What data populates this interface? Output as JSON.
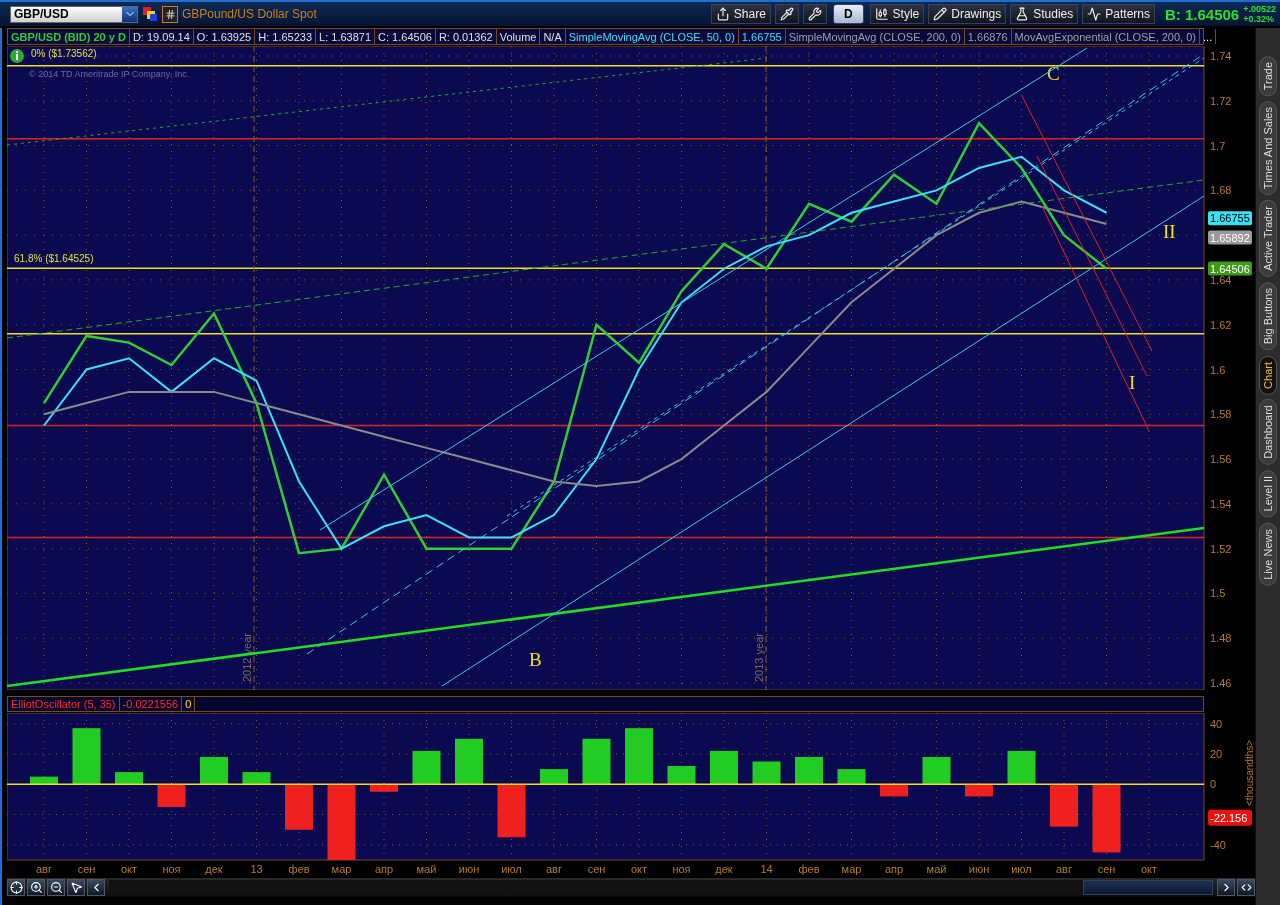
{
  "symbol": {
    "value": "GBP/USD",
    "description": "GBPound/US Dollar Spot"
  },
  "toolbar": [
    {
      "kind": "text",
      "label": "Share"
    },
    {
      "kind": "icon"
    },
    {
      "kind": "icon"
    },
    {
      "kind": "toggle",
      "label": "D"
    },
    {
      "kind": "text",
      "label": "Style"
    },
    {
      "kind": "text",
      "label": "Drawings"
    },
    {
      "kind": "text",
      "label": "Studies"
    },
    {
      "kind": "text",
      "label": "Patterns"
    }
  ],
  "quote": {
    "bid": "B: 1.64506",
    "change": "+.00522",
    "change_percent": "+0.32%"
  },
  "info_cells": [
    {
      "text": "GBP/USD (BID) 20 y D",
      "kind": "symbol"
    },
    {
      "text": "D: 19.09.14",
      "kind": "field"
    },
    {
      "text": "O: 1.63925",
      "kind": "field"
    },
    {
      "text": "H: 1.65233",
      "kind": "field"
    },
    {
      "text": "L: 1.63871",
      "kind": "field"
    },
    {
      "text": "C: 1.64506",
      "kind": "field"
    },
    {
      "text": "R: 0.01362",
      "kind": "field"
    },
    {
      "text": "Volume",
      "kind": "field"
    },
    {
      "text": "N/A",
      "kind": "field"
    },
    {
      "text": "SimpleMovingAvg (CLOSE, 50, 0)",
      "kind": "primary"
    },
    {
      "text": "1.66755",
      "kind": "primary"
    },
    {
      "text": "SimpleMovingAvg (CLOSE, 200, 0)",
      "kind": "secondary"
    },
    {
      "text": "1.66876",
      "kind": "secondary"
    },
    {
      "text": "MovAvgExponential (CLOSE, 200, 0)",
      "kind": "secondary"
    },
    {
      "text": "...",
      "kind": "more"
    }
  ],
  "copyright": "© 2014 TD Ameritrade IP Company, Inc.",
  "price_chart": {
    "chart_data": {
      "type": "line",
      "grid": true,
      "series": [
        {
          "color": "#33cc33",
          "values": [
            1.585,
            1.615,
            1.612,
            1.602,
            1.625,
            1.585,
            1.518,
            1.52,
            1.553,
            1.52,
            1.52,
            1.52,
            1.55,
            1.62,
            1.603,
            1.635,
            1.656,
            1.645,
            1.674,
            1.666,
            1.687,
            1.674,
            1.71,
            1.69,
            1.66,
            1.645,
            null
          ]
        },
        {
          "color": "#3ce0f5",
          "values": [
            1.575,
            1.6,
            1.605,
            1.59,
            1.605,
            1.595,
            1.55,
            1.52,
            1.53,
            1.535,
            1.525,
            1.525,
            1.535,
            1.56,
            1.6,
            1.63,
            1.645,
            1.655,
            1.66,
            1.67,
            1.675,
            1.68,
            1.69,
            1.695,
            1.68,
            1.67,
            null
          ]
        },
        {
          "color": "#8a8a8a",
          "values": [
            1.58,
            1.585,
            1.59,
            1.59,
            1.59,
            1.585,
            1.58,
            1.575,
            1.57,
            1.565,
            1.56,
            1.555,
            1.55,
            1.548,
            1.55,
            1.56,
            1.575,
            1.59,
            1.61,
            1.63,
            1.645,
            1.66,
            1.67,
            1.675,
            1.67,
            1.665,
            null
          ]
        }
      ],
      "ylim": [
        1.46,
        1.74
      ],
      "yticks": [
        1.46,
        1.48,
        1.5,
        1.52,
        1.54,
        1.56,
        1.58,
        1.6,
        1.62,
        1.64,
        1.68,
        1.7,
        1.72,
        1.74
      ],
      "ref_lines": [
        {
          "axis": "y",
          "value": 1.73562,
          "color": "#f0e020",
          "label": "0% ($1.73562)"
        },
        {
          "axis": "y",
          "value": 1.703,
          "color": "#e02020"
        },
        {
          "axis": "y",
          "value": 1.64525,
          "color": "#f0e020",
          "label": "61.8% ($1.64525)"
        },
        {
          "axis": "y",
          "value": 1.616,
          "color": "#f0e020"
        },
        {
          "axis": "y",
          "value": 1.575,
          "color": "#e02020"
        },
        {
          "axis": "y",
          "value": 1.525,
          "color": "#e02020"
        }
      ]
    },
    "wave_labels": [
      "C",
      "B",
      "I",
      "II"
    ],
    "year_labels": [
      "2012 year",
      "2013 year"
    ],
    "badges": [
      {
        "text": "1.66755",
        "kind": "primary"
      },
      {
        "text": "1.65892",
        "kind": "secondary"
      },
      {
        "text": "1.64506",
        "kind": "price"
      }
    ]
  },
  "oscillator": {
    "header": [
      {
        "text": "ElliotOscillator (5, 35)",
        "kind": "study"
      },
      {
        "text": "-0.0221556",
        "kind": "study"
      },
      {
        "text": "0",
        "kind": "zero"
      }
    ],
    "chart_data": {
      "type": "bar",
      "grid": true,
      "ylabel": "<thousandths>",
      "ylim": [
        -50,
        47
      ],
      "yticks": [
        40,
        20,
        0,
        -40
      ],
      "categories": [
        "авг",
        "сен",
        "окт",
        "ноя",
        "дек",
        "13",
        "фев",
        "мар",
        "апр",
        "май",
        "июн",
        "июл",
        "авг",
        "сен",
        "окт",
        "ноя",
        "дек",
        "14",
        "фев",
        "мар",
        "апр",
        "май",
        "июн",
        "июл",
        "авг",
        "сен",
        "окт"
      ],
      "values": [
        5,
        37,
        8,
        -15,
        18,
        8,
        -30,
        -50,
        -5,
        22,
        30,
        -35,
        10,
        30,
        37,
        12,
        22,
        15,
        18,
        10,
        -8,
        18,
        -8,
        22,
        -28,
        -45,
        null
      ],
      "ref_lines": [
        {
          "axis": "y",
          "value": 0,
          "color": "#f0e020"
        }
      ]
    },
    "badge": "-22.156"
  },
  "side_tabs": [
    {
      "label": "Trade",
      "selected": false
    },
    {
      "label": "Times And Sales",
      "selected": false
    },
    {
      "label": "Active Trader",
      "selected": false
    },
    {
      "label": "Big Buttons",
      "selected": false
    },
    {
      "label": "Chart",
      "selected": true
    },
    {
      "label": "Dashboard",
      "selected": false
    },
    {
      "label": "Level II",
      "selected": false
    },
    {
      "label": "Live News",
      "selected": false
    }
  ]
}
